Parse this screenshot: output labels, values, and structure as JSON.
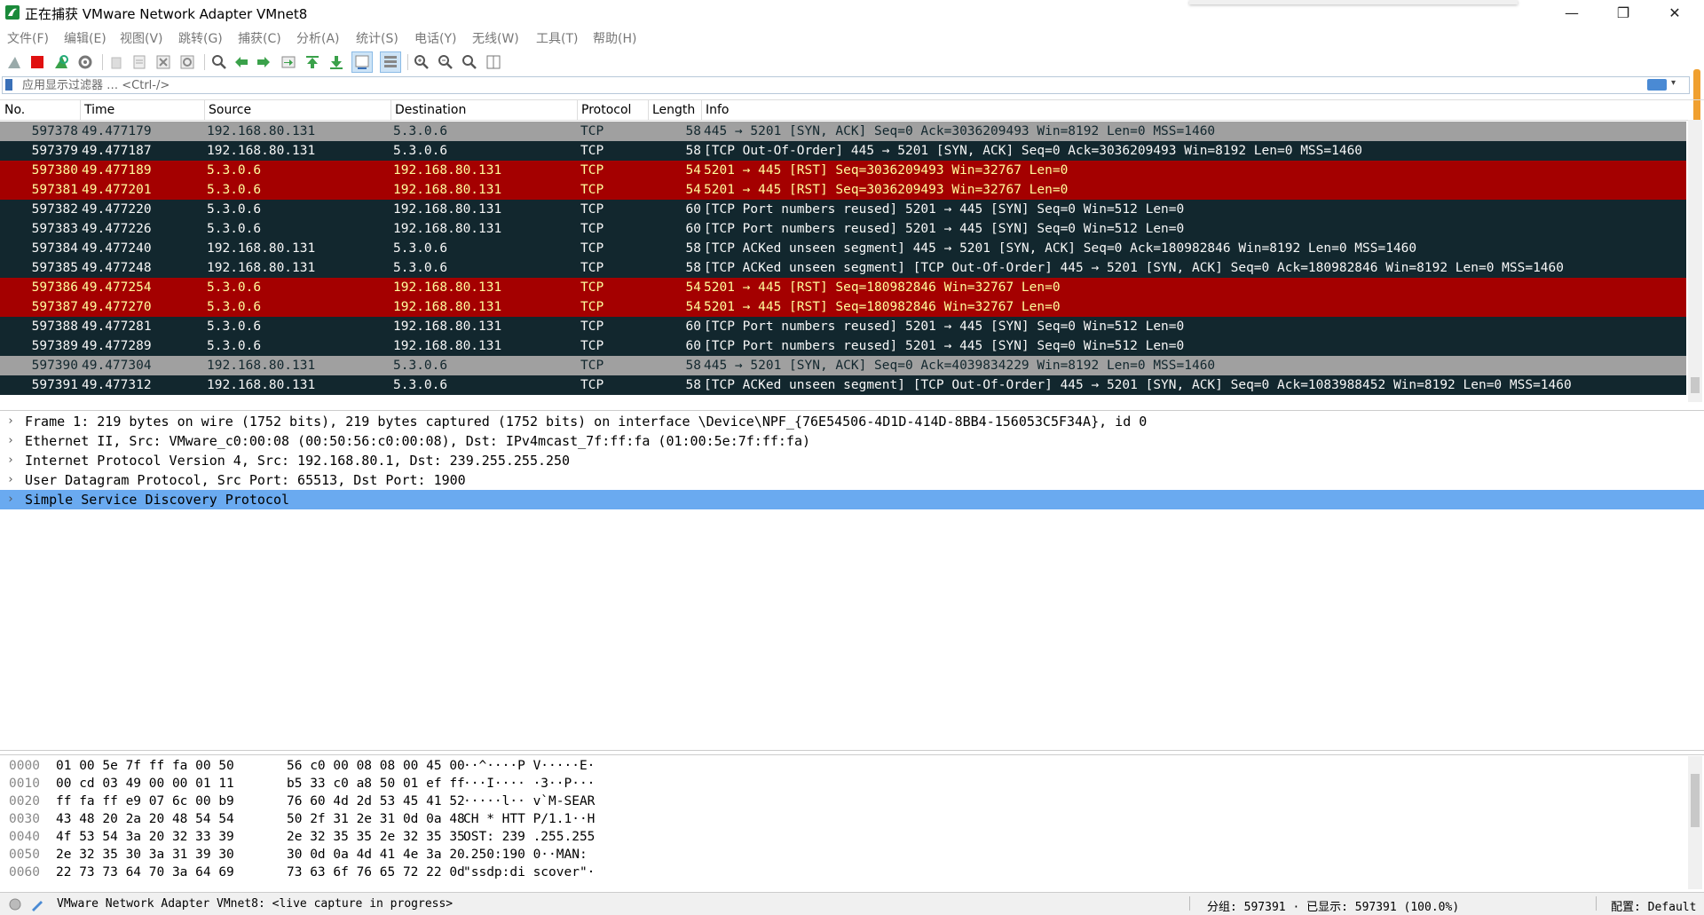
{
  "window": {
    "title": "正在捕获 VMware Network Adapter VMnet8",
    "controls": {
      "minimize": "—",
      "restore": "❐",
      "close": "✕"
    }
  },
  "menu": [
    "文件(F)",
    "编辑(E)",
    "视图(V)",
    "跳转(G)",
    "捕获(C)",
    "分析(A)",
    "统计(S)",
    "电话(Y)",
    "无线(W)",
    "工具(T)",
    "帮助(H)"
  ],
  "toolbar": {
    "icons": [
      "shark-fin-start-icon",
      "stop-capture-icon",
      "restart-capture-icon",
      "capture-options-icon",
      "open-file-icon",
      "save-file-icon",
      "close-file-icon",
      "reload-file-icon",
      "find-packet-icon",
      "go-back-icon",
      "go-forward-icon",
      "go-to-packet-icon",
      "go-first-icon",
      "go-last-icon",
      "auto-scroll-icon",
      "colorize-icon",
      "zoom-in-icon",
      "zoom-out-icon",
      "zoom-normal-icon",
      "resize-columns-icon"
    ]
  },
  "filter": {
    "placeholder": "应用显示过滤器 … <Ctrl-/>",
    "value": ""
  },
  "packet_list": {
    "columns": [
      "No.",
      "Time",
      "Source",
      "Destination",
      "Protocol",
      "Length",
      "Info"
    ],
    "rows": [
      {
        "no": "597378",
        "time": "49.477179",
        "src": "192.168.80.131",
        "dst": "5.3.0.6",
        "proto": "TCP",
        "len": "58",
        "info": "445 → 5201 [SYN, ACK] Seq=0 Ack=3036209493 Win=8192 Len=0 MSS=1460",
        "style": "gray"
      },
      {
        "no": "597379",
        "time": "49.477187",
        "src": "192.168.80.131",
        "dst": "5.3.0.6",
        "proto": "TCP",
        "len": "58",
        "info": "[TCP Out-Of-Order] 445 → 5201 [SYN, ACK] Seq=0 Ack=3036209493 Win=8192 Len=0 MSS=1460",
        "style": "dark"
      },
      {
        "no": "597380",
        "time": "49.477189",
        "src": "5.3.0.6",
        "dst": "192.168.80.131",
        "proto": "TCP",
        "len": "54",
        "info": "5201 → 445 [RST] Seq=3036209493 Win=32767 Len=0",
        "style": "red"
      },
      {
        "no": "597381",
        "time": "49.477201",
        "src": "5.3.0.6",
        "dst": "192.168.80.131",
        "proto": "TCP",
        "len": "54",
        "info": "5201 → 445 [RST] Seq=3036209493 Win=32767 Len=0",
        "style": "red"
      },
      {
        "no": "597382",
        "time": "49.477220",
        "src": "5.3.0.6",
        "dst": "192.168.80.131",
        "proto": "TCP",
        "len": "60",
        "info": "[TCP Port numbers reused] 5201 → 445 [SYN] Seq=0 Win=512 Len=0",
        "style": "dark"
      },
      {
        "no": "597383",
        "time": "49.477226",
        "src": "5.3.0.6",
        "dst": "192.168.80.131",
        "proto": "TCP",
        "len": "60",
        "info": "[TCP Port numbers reused] 5201 → 445 [SYN] Seq=0 Win=512 Len=0",
        "style": "dark"
      },
      {
        "no": "597384",
        "time": "49.477240",
        "src": "192.168.80.131",
        "dst": "5.3.0.6",
        "proto": "TCP",
        "len": "58",
        "info": "[TCP ACKed unseen segment] 445 → 5201 [SYN, ACK] Seq=0 Ack=180982846 Win=8192 Len=0 MSS=1460",
        "style": "dark"
      },
      {
        "no": "597385",
        "time": "49.477248",
        "src": "192.168.80.131",
        "dst": "5.3.0.6",
        "proto": "TCP",
        "len": "58",
        "info": "[TCP ACKed unseen segment] [TCP Out-Of-Order] 445 → 5201 [SYN, ACK] Seq=0 Ack=180982846 Win=8192 Len=0 MSS=1460",
        "style": "dark"
      },
      {
        "no": "597386",
        "time": "49.477254",
        "src": "5.3.0.6",
        "dst": "192.168.80.131",
        "proto": "TCP",
        "len": "54",
        "info": "5201 → 445 [RST] Seq=180982846 Win=32767 Len=0",
        "style": "red"
      },
      {
        "no": "597387",
        "time": "49.477270",
        "src": "5.3.0.6",
        "dst": "192.168.80.131",
        "proto": "TCP",
        "len": "54",
        "info": "5201 → 445 [RST] Seq=180982846 Win=32767 Len=0",
        "style": "red"
      },
      {
        "no": "597388",
        "time": "49.477281",
        "src": "5.3.0.6",
        "dst": "192.168.80.131",
        "proto": "TCP",
        "len": "60",
        "info": "[TCP Port numbers reused] 5201 → 445 [SYN] Seq=0 Win=512 Len=0",
        "style": "dark"
      },
      {
        "no": "597389",
        "time": "49.477289",
        "src": "5.3.0.6",
        "dst": "192.168.80.131",
        "proto": "TCP",
        "len": "60",
        "info": "[TCP Port numbers reused] 5201 → 445 [SYN] Seq=0 Win=512 Len=0",
        "style": "dark"
      },
      {
        "no": "597390",
        "time": "49.477304",
        "src": "192.168.80.131",
        "dst": "5.3.0.6",
        "proto": "TCP",
        "len": "58",
        "info": "445 → 5201 [SYN, ACK] Seq=0 Ack=4039834229 Win=8192 Len=0 MSS=1460",
        "style": "gray"
      },
      {
        "no": "597391",
        "time": "49.477312",
        "src": "192.168.80.131",
        "dst": "5.3.0.6",
        "proto": "TCP",
        "len": "58",
        "info": "[TCP ACKed unseen segment] [TCP Out-Of-Order] 445 → 5201 [SYN, ACK] Seq=0 Ack=1083988452 Win=8192 Len=0 MSS=1460",
        "style": "dark"
      }
    ]
  },
  "details": [
    {
      "text": "Frame 1: 219 bytes on wire (1752 bits), 219 bytes captured (1752 bits) on interface \\Device\\NPF_{76E54506-4D1D-414D-8BB4-156053C5F34A}, id 0",
      "selected": false
    },
    {
      "text": "Ethernet II, Src: VMware_c0:00:08 (00:50:56:c0:00:08), Dst: IPv4mcast_7f:ff:fa (01:00:5e:7f:ff:fa)",
      "selected": false
    },
    {
      "text": "Internet Protocol Version 4, Src: 192.168.80.1, Dst: 239.255.255.250",
      "selected": false
    },
    {
      "text": "User Datagram Protocol, Src Port: 65513, Dst Port: 1900",
      "selected": false
    },
    {
      "text": "Simple Service Discovery Protocol",
      "selected": true
    }
  ],
  "hex": [
    {
      "off": "0000",
      "b1": "01 00 5e 7f ff fa 00 50",
      "b2": "56 c0 00 08 08 00 45 00",
      "asc": "··^····P V·····E·"
    },
    {
      "off": "0010",
      "b1": "00 cd 03 49 00 00 01 11",
      "b2": "b5 33 c0 a8 50 01 ef ff",
      "asc": "···I···· ·3··P···"
    },
    {
      "off": "0020",
      "b1": "ff fa ff e9 07 6c 00 b9",
      "b2": "76 60 4d 2d 53 45 41 52",
      "asc": "·····l·· v`M-SEAR"
    },
    {
      "off": "0030",
      "b1": "43 48 20 2a 20 48 54 54",
      "b2": "50 2f 31 2e 31 0d 0a 48",
      "asc": "CH * HTT P/1.1··H"
    },
    {
      "off": "0040",
      "b1": "4f 53 54 3a 20 32 33 39",
      "b2": "2e 32 35 35 2e 32 35 35",
      "asc": "OST: 239 .255.255"
    },
    {
      "off": "0050",
      "b1": "2e 32 35 30 3a 31 39 30",
      "b2": "30 0d 0a 4d 41 4e 3a 20",
      "asc": ".250:190 0··MAN: "
    },
    {
      "off": "0060",
      "b1": "22 73 73 64 70 3a 64 69",
      "b2": "73 63 6f 76 65 72 22 0d",
      "asc": "\"ssdp:di scover\"·"
    }
  ],
  "status": {
    "capture": "VMware Network Adapter VMnet8: <live capture in progress>",
    "packets": "分组: 597391 · 已显示: 597391 (100.0%)",
    "profile": "配置: Default"
  },
  "colors": {
    "row_dark_bg": "#12272e",
    "row_dark_fg": "#f7f7f7",
    "row_red_bg": "#a40000",
    "row_red_fg": "#fffc9c",
    "row_gray_bg": "#a0a0a0",
    "row_gray_fg": "#12272e",
    "selected_detail": "#6aaaf0"
  }
}
